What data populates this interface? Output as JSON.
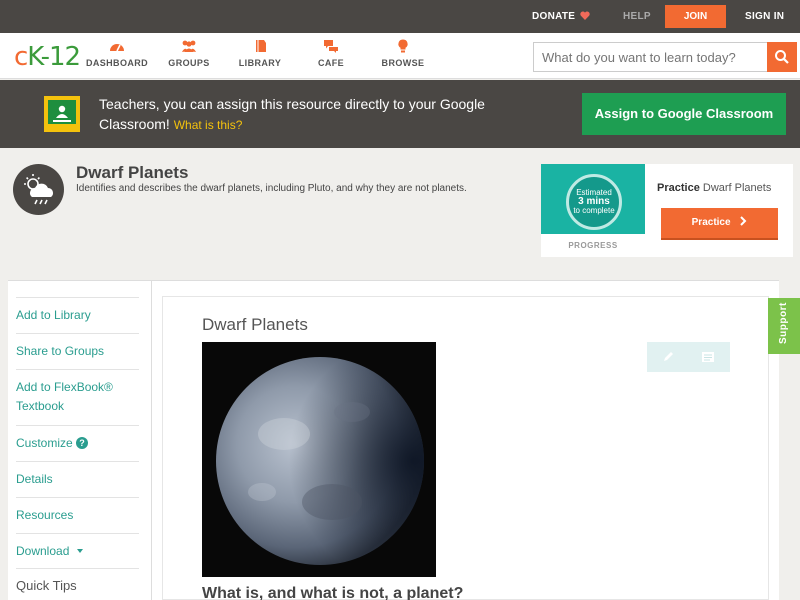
{
  "topbar": {
    "donate": "DONATE",
    "help": "HELP",
    "join": "JOIN",
    "sign_in": "SIGN IN"
  },
  "nav": {
    "logo": {
      "c": "c",
      "k": "K",
      "n": "-12"
    },
    "items": [
      {
        "label": "DASHBOARD",
        "icon": "dashboard-icon"
      },
      {
        "label": "GROUPS",
        "icon": "groups-icon"
      },
      {
        "label": "LIBRARY",
        "icon": "library-icon"
      },
      {
        "label": "CAFE",
        "icon": "cafe-icon"
      },
      {
        "label": "BROWSE",
        "icon": "browse-icon"
      }
    ],
    "search_placeholder": "What do you want to learn today?"
  },
  "banner": {
    "message": "Teachers, you can assign this resource directly to your Google Classroom!",
    "what_link": "What is this?",
    "assign_label": "Assign to Google Classroom"
  },
  "concept": {
    "title": "Dwarf Planets",
    "description": "Identifies and describes the dwarf planets, including Pluto, and why they are not planets."
  },
  "practice": {
    "estimated_label": "Estimated",
    "minutes": "3 mins",
    "to_complete": "to complete",
    "progress_label": "PROGRESS",
    "title_prefix": "Practice",
    "title_rest": "Dwarf Planets",
    "button_label": "Practice"
  },
  "sidebar": {
    "items": [
      {
        "label": "Add to Library"
      },
      {
        "label": "Share to Groups"
      },
      {
        "label": "Add to FlexBook® Textbook"
      },
      {
        "label": "Customize"
      },
      {
        "label": "Details"
      },
      {
        "label": "Resources"
      },
      {
        "label": "Download"
      }
    ],
    "quick_tips": "Quick Tips"
  },
  "lesson": {
    "title": "Dwarf Planets",
    "subheading": "What is, and what is not, a planet?"
  },
  "support_label": "Support",
  "colors": {
    "brand_orange": "#f26a32",
    "dark_bar": "#4a4744",
    "google_green": "#1e9e52",
    "link_teal": "#2a9d8f",
    "support_green": "#7cc24a"
  }
}
